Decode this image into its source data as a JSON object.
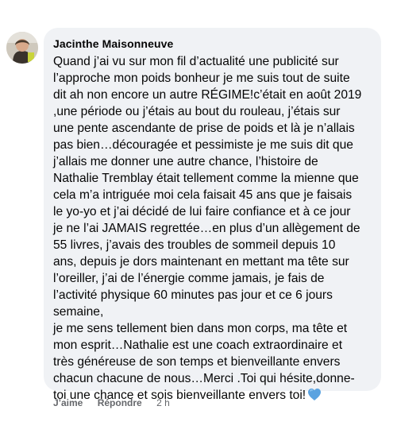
{
  "comment": {
    "author": "Jacinthe Maisonneuve",
    "lines": [
      "Quand j’ai vu sur mon fil d’actualité une publicité sur",
      "l’approche mon poids bonheur je me suis tout de suite",
      "dit ah non encore un autre RÉGIME!c’était en août 2019",
      ",une période ou j’étais au bout du rouleau, j’étais sur",
      "une pente ascendante de prise de poids et là je n’allais",
      "pas bien…découragée et pessimiste je me suis dit que",
      "j’allais me donner une autre chance, l’histoire de",
      "Nathalie Tremblay était tellement comme la mienne que",
      "cela m’a intriguée moi cela faisait 45 ans que je faisais",
      "le yo-yo et j’ai décidé de lui faire confiance et à ce jour",
      "je ne l’ai JAMAIS regrettée…en plus d’un allègement de",
      "55 livres, j’avais des troubles de sommeil depuis 10",
      "ans, depuis je dors maintenant en mettant ma tête sur",
      "l’oreiller, j’ai de l’énergie comme jamais, je fais de",
      "l’activité physique 60 minutes pas jour et ce 6 jours",
      "semaine,",
      "je me sens tellement bien dans mon corps, ma tête et",
      "mon esprit…Nathalie est une coach extraordinaire et",
      "très généreuse de son temps et bienveillante envers",
      "chacun chacune de nous…Merci .Toi qui hésite,donne-",
      "toi une chance et sois bienveillante envers toi!"
    ],
    "end_emoji": "blue-heart-icon"
  },
  "actions": {
    "like_label": "J’aime",
    "reply_label": "Répondre",
    "timestamp": "2 h"
  },
  "colors": {
    "bubble_bg": "#f0f2f5",
    "text": "#050505",
    "secondary_text": "#65676b",
    "heart": "#5ba3e0"
  }
}
